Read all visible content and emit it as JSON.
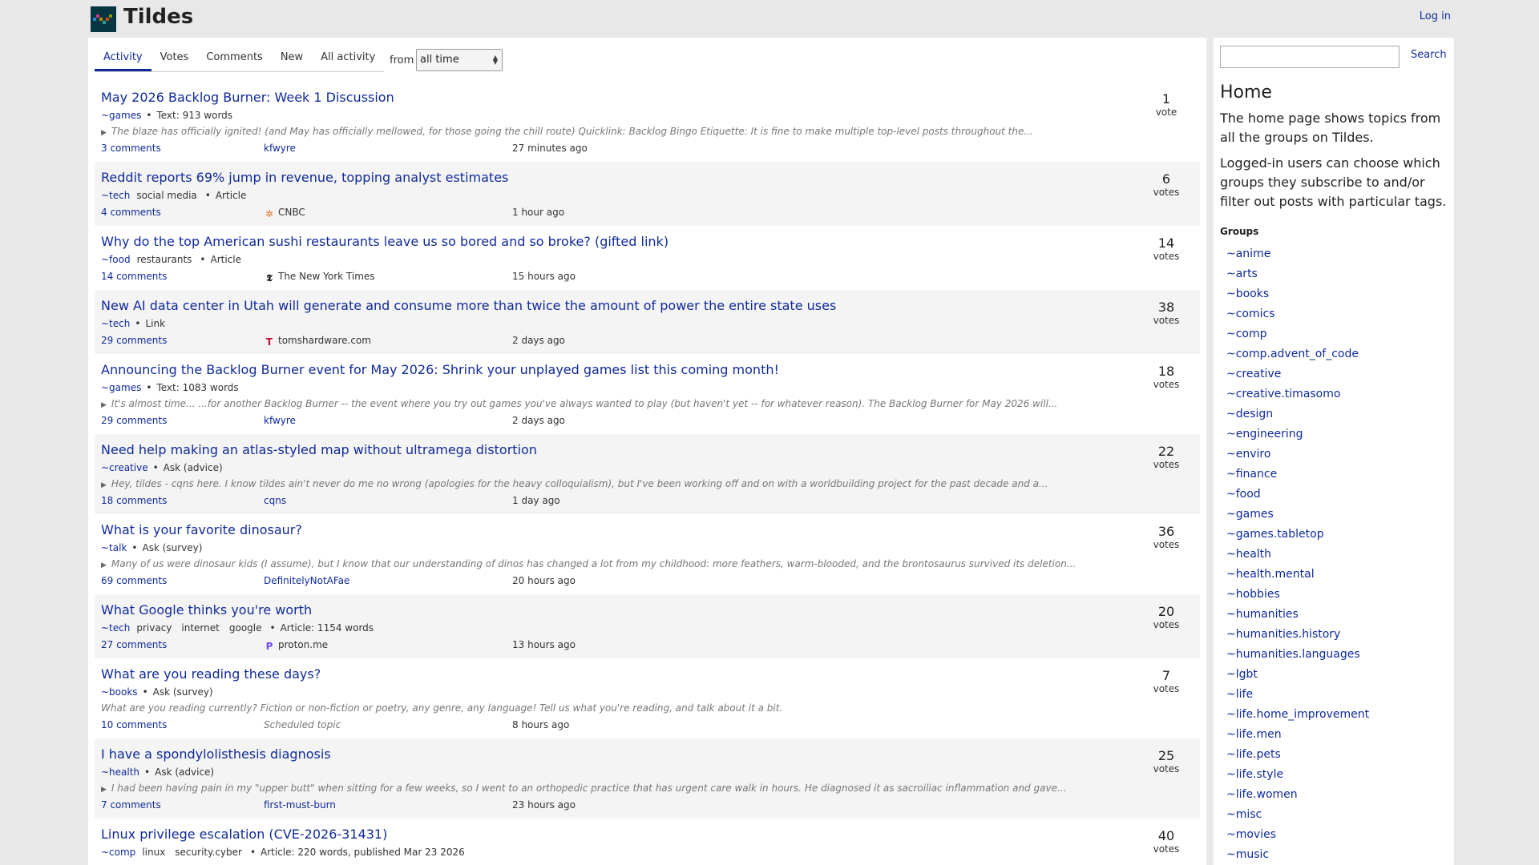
{
  "header": {
    "site_title": "Tildes",
    "login": "Log in"
  },
  "tabs": [
    {
      "label": "Activity",
      "active": true
    },
    {
      "label": "Votes",
      "active": false
    },
    {
      "label": "Comments",
      "active": false
    },
    {
      "label": "New",
      "active": false
    },
    {
      "label": "All activity",
      "active": false
    }
  ],
  "period": {
    "label": "from",
    "value": "all time"
  },
  "topics": [
    {
      "title": "May 2026 Backlog Burner: Week 1 Discussion",
      "group": "~games",
      "tags": [],
      "type": "Text: 913 words",
      "excerpt": "The blaze has officially ignited! (and May has officially mellowed, for those going the chill route) Quicklink: Backlog Bingo Etiquette: It is fine to make multiple top-level posts throughout the...",
      "excerpt_expandable": true,
      "comments": "3 comments",
      "author": "kfwyre",
      "source": "",
      "time": "27 minutes ago",
      "votes": "1",
      "votes_label": "vote"
    },
    {
      "title": "Reddit reports 69% jump in revenue, topping analyst estimates",
      "group": "~tech",
      "tags": [
        "social media"
      ],
      "type": "Article",
      "excerpt": "",
      "comments": "4 comments",
      "author": "",
      "source": "CNBC",
      "source_icon": "cnbc-peacock-icon",
      "time": "1 hour ago",
      "votes": "6",
      "votes_label": "votes"
    },
    {
      "title": "Why do the top American sushi restaurants leave us so bored and so broke? (gifted link)",
      "group": "~food",
      "tags": [
        "restaurants"
      ],
      "type": "Article",
      "excerpt": "",
      "comments": "14 comments",
      "author": "",
      "source": "The New York Times",
      "source_icon": "nyt-icon",
      "time": "15 hours ago",
      "votes": "14",
      "votes_label": "votes"
    },
    {
      "title": "New AI data center in Utah will generate and consume more than twice the amount of power the entire state uses",
      "group": "~tech",
      "tags": [],
      "type": "Link",
      "excerpt": "",
      "comments": "29 comments",
      "author": "",
      "source": "tomshardware.com",
      "source_icon": "tomshardware-icon",
      "time": "2 days ago",
      "votes": "38",
      "votes_label": "votes"
    },
    {
      "title": "Announcing the Backlog Burner event for May 2026: Shrink your unplayed games list this coming month!",
      "group": "~games",
      "tags": [],
      "type": "Text: 1083 words",
      "excerpt": "It's almost time... ...for another Backlog Burner -- the event where you try out games you've always wanted to play (but haven't yet -- for whatever reason). The Backlog Burner for May 2026 will...",
      "excerpt_expandable": true,
      "comments": "29 comments",
      "author": "kfwyre",
      "source": "",
      "time": "2 days ago",
      "votes": "18",
      "votes_label": "votes"
    },
    {
      "title": "Need help making an atlas-styled map without ultramega distortion",
      "group": "~creative",
      "tags": [],
      "type": "Ask (advice)",
      "excerpt": "Hey, tildes - cqns here. I know tildes ain't never do me no wrong (apologies for the heavy colloquialism), but I've been working off and on with a worldbuilding project for the past decade and a...",
      "excerpt_expandable": true,
      "comments": "18 comments",
      "author": "cqns",
      "source": "",
      "time": "1 day ago",
      "votes": "22",
      "votes_label": "votes"
    },
    {
      "title": "What is your favorite dinosaur?",
      "group": "~talk",
      "tags": [],
      "type": "Ask (survey)",
      "excerpt": "Many of us were dinosaur kids (I assume), but I know that our understanding of dinos has changed a lot from my childhood: more feathers, warm-blooded, and the brontosaurus survived its deletion...",
      "excerpt_expandable": true,
      "comments": "69 comments",
      "author": "DefinitelyNotAFae",
      "source": "",
      "time": "20 hours ago",
      "votes": "36",
      "votes_label": "votes"
    },
    {
      "title": "What Google thinks you're worth",
      "group": "~tech",
      "tags": [
        "privacy",
        "internet",
        "google"
      ],
      "type": "Article: 1154 words",
      "excerpt": "",
      "comments": "27 comments",
      "author": "",
      "source": "proton.me",
      "source_icon": "proton-icon",
      "time": "13 hours ago",
      "votes": "20",
      "votes_label": "votes"
    },
    {
      "title": "What are you reading these days?",
      "group": "~books",
      "tags": [],
      "type": "Ask (survey)",
      "excerpt": "What are you reading currently? Fiction or non-fiction or poetry, any genre, any language! Tell us what you're reading, and talk about it a bit.",
      "excerpt_expandable": false,
      "comments": "10 comments",
      "author": "",
      "source": "",
      "scheduled": "Scheduled topic",
      "time": "8 hours ago",
      "votes": "7",
      "votes_label": "votes"
    },
    {
      "title": "I have a spondylolisthesis diagnosis",
      "group": "~health",
      "tags": [],
      "type": "Ask (advice)",
      "excerpt": "I had been having pain in my \"upper butt\" when sitting for a few weeks, so I went to an orthopedic practice that has urgent care walk in hours. He diagnosed it as sacroiliac inflammation and gave...",
      "excerpt_expandable": true,
      "comments": "7 comments",
      "author": "first-must-burn",
      "source": "",
      "time": "23 hours ago",
      "votes": "25",
      "votes_label": "votes"
    },
    {
      "title": "Linux privilege escalation (CVE-2026-31431)",
      "group": "~comp",
      "tags": [
        "linux",
        "security.cyber"
      ],
      "type": "Article: 220 words, published Mar 23 2026",
      "excerpt": "",
      "comments": "",
      "author": "",
      "source": "",
      "time": "",
      "votes": "40",
      "votes_label": "votes"
    }
  ],
  "sidebar": {
    "search_button": "Search",
    "title": "Home",
    "para1": "The home page shows topics from all the groups on Tildes.",
    "para2": "Logged-in users can choose which groups they subscribe to and/or filter out posts with particular tags.",
    "groups_heading": "Groups",
    "groups": [
      "~anime",
      "~arts",
      "~books",
      "~comics",
      "~comp",
      "~comp.advent_of_code",
      "~creative",
      "~creative.timasomo",
      "~design",
      "~engineering",
      "~enviro",
      "~finance",
      "~food",
      "~games",
      "~games.tabletop",
      "~health",
      "~health.mental",
      "~hobbies",
      "~humanities",
      "~humanities.history",
      "~humanities.languages",
      "~lgbt",
      "~life",
      "~life.home_improvement",
      "~life.men",
      "~life.pets",
      "~life.style",
      "~life.women",
      "~misc",
      "~movies",
      "~music"
    ]
  },
  "colors": {
    "link": "#0f2a9a",
    "background": "#e8e8e8",
    "alt_row": "#f4f4f4"
  }
}
